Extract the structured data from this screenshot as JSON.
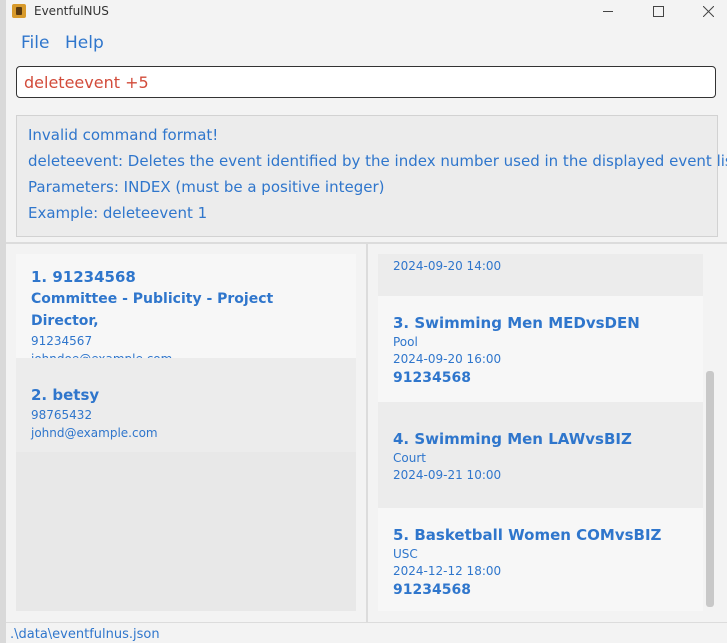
{
  "window": {
    "title": "EventfulNUS"
  },
  "menu": {
    "file": "File",
    "help": "Help"
  },
  "command": {
    "value": "deleteevent +5"
  },
  "result": {
    "lines": [
      "Invalid command format!",
      "deleteevent: Deletes the event identified by the index number used in the displayed event list.",
      "Parameters: INDEX (must be a positive integer)",
      "Example: deleteevent 1"
    ]
  },
  "persons": [
    {
      "name": "1. 91234568",
      "roles": "Committee - Publicity - Project Director,",
      "phone": "91234567",
      "email": "johndoe@example.com"
    },
    {
      "name": "2. betsy",
      "roles": "",
      "phone": "98765432",
      "email": "johnd@example.com"
    }
  ],
  "events": {
    "partial": {
      "datetime": "2024-09-20 14:00"
    },
    "items": [
      {
        "name": "3. Swimming Men MEDvsDEN",
        "venue": "Pool",
        "datetime": "2024-09-20 16:00",
        "contact": "91234568"
      },
      {
        "name": "4. Swimming Men LAWvsBIZ",
        "venue": "Court",
        "datetime": "2024-09-21 10:00",
        "contact": ""
      },
      {
        "name": "5. Basketball Women COMvsBIZ",
        "venue": "USC",
        "datetime": "2024-12-12 18:00",
        "contact": "91234568"
      }
    ]
  },
  "status": {
    "path": ".\\data\\eventfulnus.json"
  },
  "colors": {
    "accent": "#2f76cc",
    "error": "#d24b3a"
  }
}
